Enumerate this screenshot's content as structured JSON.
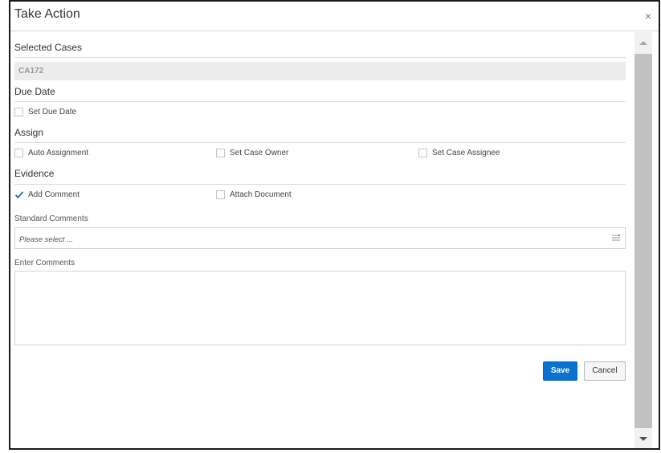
{
  "dialog": {
    "title": "Take Action",
    "close_icon": "close-icon",
    "close_glyph": "×"
  },
  "sections": {
    "selected_cases": {
      "title": "Selected Cases",
      "case_id": "CA172"
    },
    "due_date": {
      "title": "Due Date",
      "checkbox": {
        "label": "Set Due Date",
        "checked": false
      }
    },
    "assign": {
      "title": "Assign",
      "checkboxes": [
        {
          "label": "Auto Assignment",
          "checked": false
        },
        {
          "label": "Set Case Owner",
          "checked": false
        },
        {
          "label": "Set Case Assignee",
          "checked": false
        }
      ]
    },
    "evidence": {
      "title": "Evidence",
      "checkboxes": [
        {
          "label": "Add Comment",
          "checked": true
        },
        {
          "label": "Attach Document",
          "checked": false
        }
      ],
      "standard_comments": {
        "label": "Standard Comments",
        "placeholder": "Please select ...",
        "icon": "list-icon"
      },
      "enter_comments": {
        "label": "Enter Comments",
        "value": ""
      }
    }
  },
  "buttons": {
    "save_label": "Save",
    "cancel_label": "Cancel"
  },
  "colors": {
    "primary": "#0b72d0",
    "checkmark": "#1f63c4",
    "scroll_thumb": "#c1c1c1"
  }
}
